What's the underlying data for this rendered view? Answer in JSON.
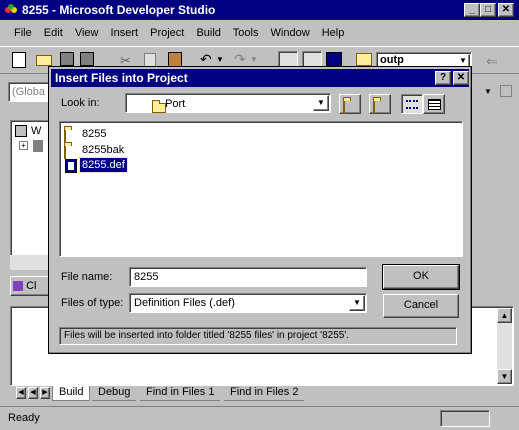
{
  "app": {
    "title": "8255 - Microsoft Developer Studio",
    "menu": [
      "File",
      "Edit",
      "View",
      "Insert",
      "Project",
      "Build",
      "Tools",
      "Window",
      "Help"
    ],
    "toolbar_combo": "outp",
    "global_combo": "(Globa",
    "workspace_partial": "W",
    "classview_partial": "Cl",
    "output_tabs": [
      "Build",
      "Debug",
      "Find in Files 1",
      "Find in Files 2"
    ],
    "status": "Ready",
    "window_buttons": [
      "_",
      "□",
      "✕"
    ]
  },
  "dialog": {
    "title": "Insert Files into Project",
    "help_btn": "?",
    "close_btn": "✕",
    "lookin_label": "Look in:",
    "lookin_value": "Port",
    "files": [
      {
        "name": "8255",
        "type": "folder"
      },
      {
        "name": "8255bak",
        "type": "folder"
      },
      {
        "name": "8255.def",
        "type": "file",
        "selected": true
      }
    ],
    "filename_label": "File name:",
    "filename_value": "8255",
    "filetype_label": "Files of type:",
    "filetype_value": "Definition Files (.def)",
    "ok_label": "OK",
    "cancel_label": "Cancel",
    "info_text": "Files will be inserted into folder titled '8255 files' in project '8255'."
  }
}
